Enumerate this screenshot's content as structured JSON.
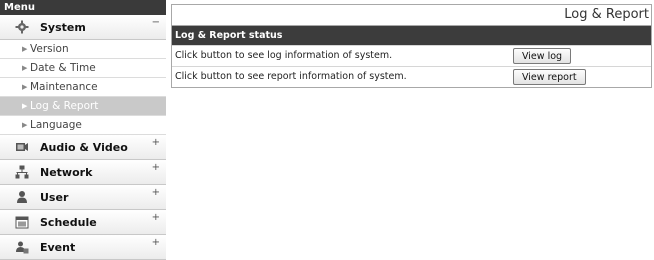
{
  "menu": {
    "header": "Menu"
  },
  "sidebar": {
    "system": {
      "label": "System",
      "sign": "−",
      "items": [
        {
          "label": "Version"
        },
        {
          "label": "Date & Time"
        },
        {
          "label": "Maintenance"
        },
        {
          "label": "Log & Report"
        },
        {
          "label": "Language"
        }
      ]
    },
    "sections": [
      {
        "label": "Audio & Video",
        "sign": "+"
      },
      {
        "label": "Network",
        "sign": "+"
      },
      {
        "label": "User",
        "sign": "+"
      },
      {
        "label": "Schedule",
        "sign": "+"
      },
      {
        "label": "Event",
        "sign": "+"
      }
    ]
  },
  "main": {
    "page_title": "Log & Report",
    "panel_title": "Log & Report status",
    "rows": [
      {
        "text": "Click button to see log information of system.",
        "button": "View log"
      },
      {
        "text": "Click button to see report information of system.",
        "button": "View report"
      }
    ]
  },
  "colors": {
    "menu_header": "#3a3a3a",
    "panel_header": "#3c3c3c",
    "active_item": "#c9c9c9"
  },
  "icons": [
    "system-gear-icon",
    "audio-video-icon",
    "network-icon",
    "user-icon",
    "schedule-calendar-icon",
    "event-icon"
  ]
}
